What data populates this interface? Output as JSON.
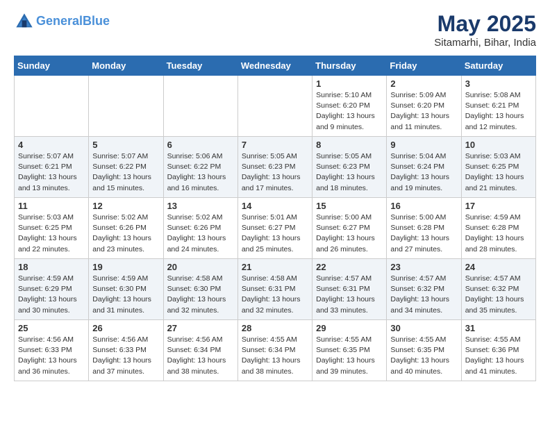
{
  "header": {
    "logo_line1": "General",
    "logo_line2": "Blue",
    "main_title": "May 2025",
    "sub_title": "Sitamarhi, Bihar, India"
  },
  "days_of_week": [
    "Sunday",
    "Monday",
    "Tuesday",
    "Wednesday",
    "Thursday",
    "Friday",
    "Saturday"
  ],
  "weeks": [
    [
      {
        "num": "",
        "info": ""
      },
      {
        "num": "",
        "info": ""
      },
      {
        "num": "",
        "info": ""
      },
      {
        "num": "",
        "info": ""
      },
      {
        "num": "1",
        "info": "Sunrise: 5:10 AM\nSunset: 6:20 PM\nDaylight: 13 hours\nand 9 minutes."
      },
      {
        "num": "2",
        "info": "Sunrise: 5:09 AM\nSunset: 6:20 PM\nDaylight: 13 hours\nand 11 minutes."
      },
      {
        "num": "3",
        "info": "Sunrise: 5:08 AM\nSunset: 6:21 PM\nDaylight: 13 hours\nand 12 minutes."
      }
    ],
    [
      {
        "num": "4",
        "info": "Sunrise: 5:07 AM\nSunset: 6:21 PM\nDaylight: 13 hours\nand 13 minutes."
      },
      {
        "num": "5",
        "info": "Sunrise: 5:07 AM\nSunset: 6:22 PM\nDaylight: 13 hours\nand 15 minutes."
      },
      {
        "num": "6",
        "info": "Sunrise: 5:06 AM\nSunset: 6:22 PM\nDaylight: 13 hours\nand 16 minutes."
      },
      {
        "num": "7",
        "info": "Sunrise: 5:05 AM\nSunset: 6:23 PM\nDaylight: 13 hours\nand 17 minutes."
      },
      {
        "num": "8",
        "info": "Sunrise: 5:05 AM\nSunset: 6:23 PM\nDaylight: 13 hours\nand 18 minutes."
      },
      {
        "num": "9",
        "info": "Sunrise: 5:04 AM\nSunset: 6:24 PM\nDaylight: 13 hours\nand 19 minutes."
      },
      {
        "num": "10",
        "info": "Sunrise: 5:03 AM\nSunset: 6:25 PM\nDaylight: 13 hours\nand 21 minutes."
      }
    ],
    [
      {
        "num": "11",
        "info": "Sunrise: 5:03 AM\nSunset: 6:25 PM\nDaylight: 13 hours\nand 22 minutes."
      },
      {
        "num": "12",
        "info": "Sunrise: 5:02 AM\nSunset: 6:26 PM\nDaylight: 13 hours\nand 23 minutes."
      },
      {
        "num": "13",
        "info": "Sunrise: 5:02 AM\nSunset: 6:26 PM\nDaylight: 13 hours\nand 24 minutes."
      },
      {
        "num": "14",
        "info": "Sunrise: 5:01 AM\nSunset: 6:27 PM\nDaylight: 13 hours\nand 25 minutes."
      },
      {
        "num": "15",
        "info": "Sunrise: 5:00 AM\nSunset: 6:27 PM\nDaylight: 13 hours\nand 26 minutes."
      },
      {
        "num": "16",
        "info": "Sunrise: 5:00 AM\nSunset: 6:28 PM\nDaylight: 13 hours\nand 27 minutes."
      },
      {
        "num": "17",
        "info": "Sunrise: 4:59 AM\nSunset: 6:28 PM\nDaylight: 13 hours\nand 28 minutes."
      }
    ],
    [
      {
        "num": "18",
        "info": "Sunrise: 4:59 AM\nSunset: 6:29 PM\nDaylight: 13 hours\nand 30 minutes."
      },
      {
        "num": "19",
        "info": "Sunrise: 4:59 AM\nSunset: 6:30 PM\nDaylight: 13 hours\nand 31 minutes."
      },
      {
        "num": "20",
        "info": "Sunrise: 4:58 AM\nSunset: 6:30 PM\nDaylight: 13 hours\nand 32 minutes."
      },
      {
        "num": "21",
        "info": "Sunrise: 4:58 AM\nSunset: 6:31 PM\nDaylight: 13 hours\nand 32 minutes."
      },
      {
        "num": "22",
        "info": "Sunrise: 4:57 AM\nSunset: 6:31 PM\nDaylight: 13 hours\nand 33 minutes."
      },
      {
        "num": "23",
        "info": "Sunrise: 4:57 AM\nSunset: 6:32 PM\nDaylight: 13 hours\nand 34 minutes."
      },
      {
        "num": "24",
        "info": "Sunrise: 4:57 AM\nSunset: 6:32 PM\nDaylight: 13 hours\nand 35 minutes."
      }
    ],
    [
      {
        "num": "25",
        "info": "Sunrise: 4:56 AM\nSunset: 6:33 PM\nDaylight: 13 hours\nand 36 minutes."
      },
      {
        "num": "26",
        "info": "Sunrise: 4:56 AM\nSunset: 6:33 PM\nDaylight: 13 hours\nand 37 minutes."
      },
      {
        "num": "27",
        "info": "Sunrise: 4:56 AM\nSunset: 6:34 PM\nDaylight: 13 hours\nand 38 minutes."
      },
      {
        "num": "28",
        "info": "Sunrise: 4:55 AM\nSunset: 6:34 PM\nDaylight: 13 hours\nand 38 minutes."
      },
      {
        "num": "29",
        "info": "Sunrise: 4:55 AM\nSunset: 6:35 PM\nDaylight: 13 hours\nand 39 minutes."
      },
      {
        "num": "30",
        "info": "Sunrise: 4:55 AM\nSunset: 6:35 PM\nDaylight: 13 hours\nand 40 minutes."
      },
      {
        "num": "31",
        "info": "Sunrise: 4:55 AM\nSunset: 6:36 PM\nDaylight: 13 hours\nand 41 minutes."
      }
    ]
  ]
}
